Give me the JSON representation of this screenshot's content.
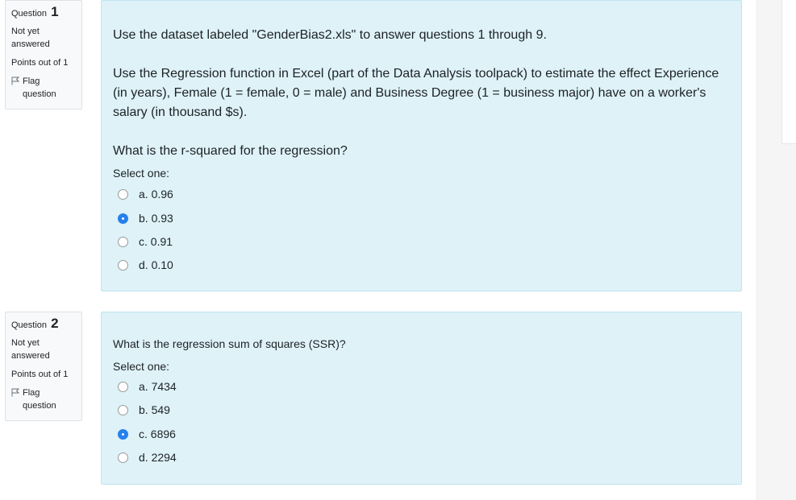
{
  "accent_color": "#2680eb",
  "questions": [
    {
      "label": "Question",
      "number": "1",
      "state": "Not yet answered",
      "grade": "Points out of 1",
      "flag_label": "Flag question",
      "text": [
        "Use the dataset labeled \"GenderBias2.xls\" to answer questions 1 through 9.",
        "Use the Regression function in Excel (part of the Data Analysis toolpack) to estimate the effect Experience (in years), Female (1 = female, 0 = male) and Business Degree (1 = business major) have on a worker's salary (in thousand $s).",
        "What is the r-squared for the regression?"
      ],
      "select_label": "Select one:",
      "options": [
        {
          "label": "a. 0.96",
          "checked": false
        },
        {
          "label": "b. 0.93",
          "checked": true
        },
        {
          "label": "c. 0.91",
          "checked": false
        },
        {
          "label": "d. 0.10",
          "checked": false
        }
      ]
    },
    {
      "label": "Question",
      "number": "2",
      "state": "Not yet answered",
      "grade": "Points out of 1",
      "flag_label": "Flag question",
      "text": [
        "What is the regression sum of squares (SSR)?"
      ],
      "select_label": "Select one:",
      "options": [
        {
          "label": "a. 7434",
          "checked": false
        },
        {
          "label": "b. 549",
          "checked": false
        },
        {
          "label": "c. 6896",
          "checked": true
        },
        {
          "label": "d. 2294",
          "checked": false
        }
      ]
    }
  ]
}
